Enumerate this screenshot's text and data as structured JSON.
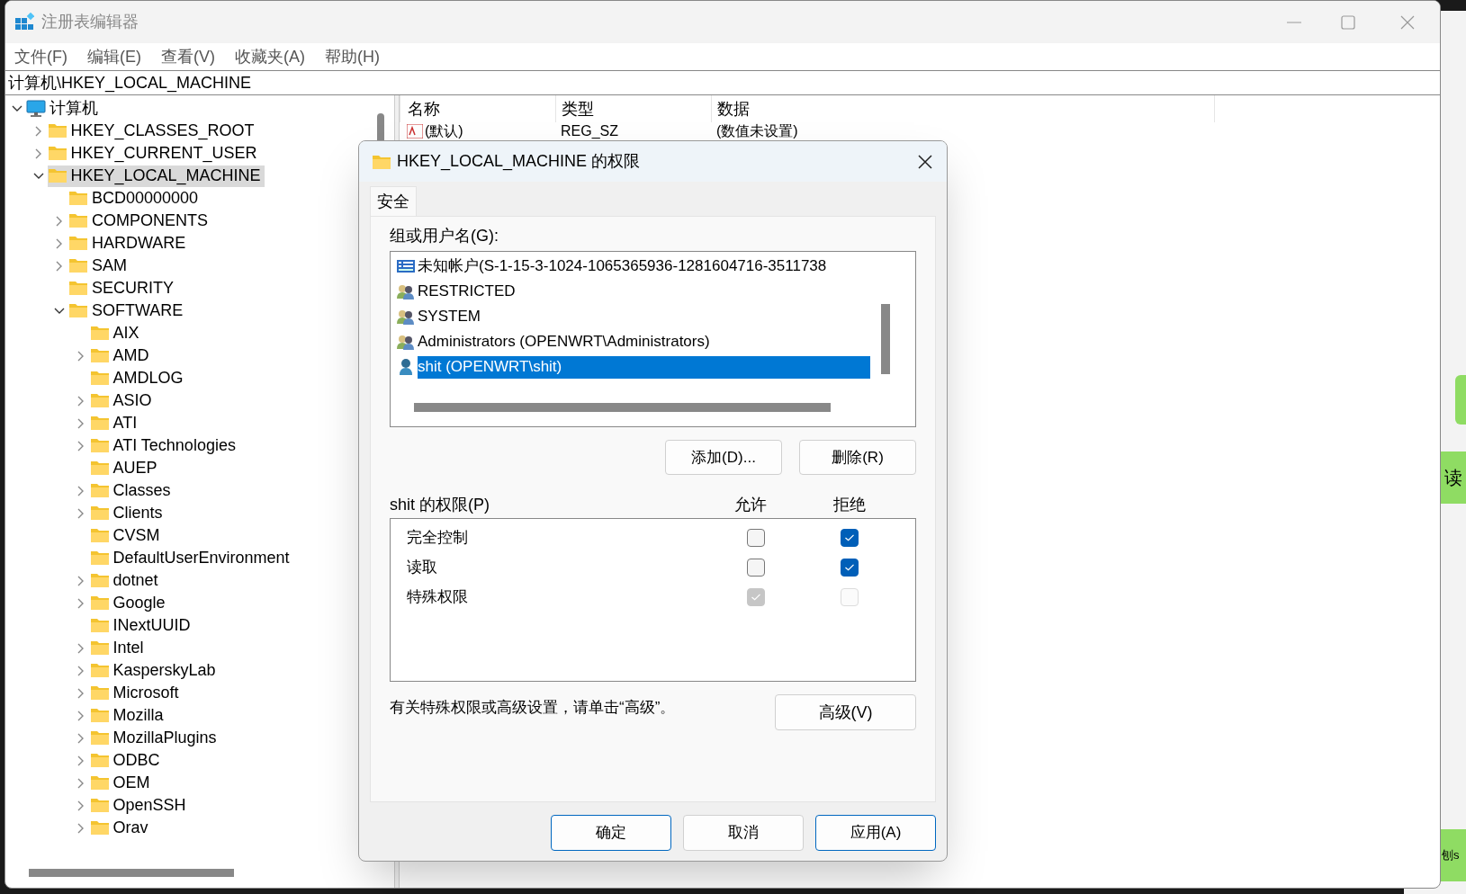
{
  "window": {
    "title": "注册表编辑器"
  },
  "menu": [
    "文件(F)",
    "编辑(E)",
    "查看(V)",
    "收藏夹(A)",
    "帮助(H)"
  ],
  "address": "计算机\\HKEY_LOCAL_MACHINE",
  "tree": {
    "label": "计算机",
    "kind": "computer",
    "expanded": true,
    "selected": false,
    "children": [
      {
        "label": "HKEY_CLASSES_ROOT",
        "expanded": false,
        "selected": false
      },
      {
        "label": "HKEY_CURRENT_USER",
        "expanded": false,
        "selected": false
      },
      {
        "label": "HKEY_LOCAL_MACHINE",
        "expanded": true,
        "selected": true,
        "children": [
          {
            "label": "BCD00000000",
            "selected": false
          },
          {
            "label": "COMPONENTS",
            "expanded": false,
            "selected": false
          },
          {
            "label": "HARDWARE",
            "expanded": false,
            "selected": false
          },
          {
            "label": "SAM",
            "expanded": false,
            "selected": false
          },
          {
            "label": "SECURITY",
            "selected": false
          },
          {
            "label": "SOFTWARE",
            "expanded": true,
            "selected": false,
            "children": [
              {
                "label": "AIX",
                "selected": false
              },
              {
                "label": "AMD",
                "expanded": false,
                "selected": false
              },
              {
                "label": "AMDLOG",
                "selected": false
              },
              {
                "label": "ASIO",
                "expanded": false,
                "selected": false
              },
              {
                "label": "ATI",
                "expanded": false,
                "selected": false
              },
              {
                "label": "ATI Technologies",
                "expanded": false,
                "selected": false
              },
              {
                "label": "AUEP",
                "selected": false
              },
              {
                "label": "Classes",
                "expanded": false,
                "selected": false
              },
              {
                "label": "Clients",
                "expanded": false,
                "selected": false
              },
              {
                "label": "CVSM",
                "selected": false
              },
              {
                "label": "DefaultUserEnvironment",
                "selected": false
              },
              {
                "label": "dotnet",
                "expanded": false,
                "selected": false
              },
              {
                "label": "Google",
                "expanded": false,
                "selected": false
              },
              {
                "label": "INextUUID",
                "selected": false
              },
              {
                "label": "Intel",
                "expanded": false,
                "selected": false
              },
              {
                "label": "KasperskyLab",
                "expanded": false,
                "selected": false
              },
              {
                "label": "Microsoft",
                "expanded": false,
                "selected": false
              },
              {
                "label": "Mozilla",
                "expanded": false,
                "selected": false
              },
              {
                "label": "MozillaPlugins",
                "expanded": false,
                "selected": false
              },
              {
                "label": "ODBC",
                "expanded": false,
                "selected": false
              },
              {
                "label": "OEM",
                "expanded": false,
                "selected": false
              },
              {
                "label": "OpenSSH",
                "expanded": false,
                "selected": false
              },
              {
                "label": "Orav",
                "expanded": false,
                "selected": false
              }
            ]
          }
        ]
      }
    ]
  },
  "values_table": {
    "columns": [
      "名称",
      "类型",
      "数据"
    ],
    "rows": [
      {
        "name": "(默认)",
        "type": "REG_SZ",
        "data": "(数值未设置)"
      }
    ]
  },
  "dialog": {
    "title": "HKEY_LOCAL_MACHINE 的权限",
    "tabs": [
      {
        "label": "安全",
        "selected": true
      }
    ],
    "group_label": "组或用户名(G):",
    "principals": [
      {
        "label": "未知帐户(S-1-15-3-1024-1065365936-1281604716-3511738",
        "kind": "computer",
        "selected": false
      },
      {
        "label": "RESTRICTED",
        "kind": "group",
        "selected": false
      },
      {
        "label": "SYSTEM",
        "kind": "group",
        "selected": false
      },
      {
        "label": "Administrators (OPENWRT\\Administrators)",
        "kind": "group",
        "selected": false
      },
      {
        "label": "shit (OPENWRT\\shit)",
        "kind": "user",
        "selected": true
      }
    ],
    "list_buttons": [
      "添加(D)...",
      "删除(R)"
    ],
    "permissions_label": "shit 的权限(P)",
    "permission_columns": [
      "允许",
      "拒绝"
    ],
    "permissions": [
      {
        "label": "完全控制",
        "allow": {
          "checked": false,
          "disabled": false
        },
        "deny": {
          "checked": true,
          "disabled": false
        }
      },
      {
        "label": "读取",
        "allow": {
          "checked": false,
          "disabled": false
        },
        "deny": {
          "checked": true,
          "disabled": false
        }
      },
      {
        "label": "特殊权限",
        "allow": {
          "checked": true,
          "disabled": true
        },
        "deny": {
          "checked": false,
          "disabled": true
        }
      }
    ],
    "hint": "有关特殊权限或高级设置，请单击“高级”。",
    "advanced_button": "高级(V)",
    "footer_buttons": [
      {
        "label": "确定",
        "emphasized": true
      },
      {
        "label": "取消",
        "emphasized": false
      },
      {
        "label": "应用(A)",
        "emphasized": true
      }
    ]
  },
  "background_app": {
    "texts": [
      "读",
      "刨s"
    ]
  }
}
